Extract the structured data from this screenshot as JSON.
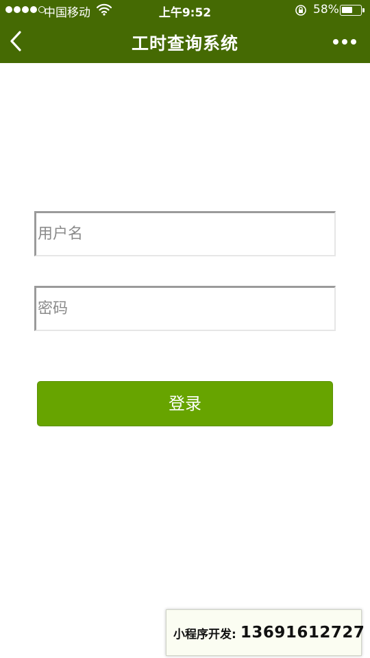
{
  "status_bar": {
    "carrier": "中国移动",
    "time": "上午9:52",
    "battery_percent": "58%",
    "battery_level": 0.58,
    "signal_strength": 4,
    "signal_max": 5,
    "icons": [
      "signal-icon",
      "wifi-icon",
      "rotation-lock-icon",
      "battery-icon"
    ]
  },
  "navbar": {
    "title": "工时查询系统",
    "back_icon": "chevron-left-icon",
    "more_icon": "more-dots-icon"
  },
  "form": {
    "username_placeholder": "用户名",
    "password_placeholder": "密码",
    "username_value": "",
    "password_value": "",
    "login_label": "登录"
  },
  "promo": {
    "label": "小程序开发:",
    "phone": "13691612727"
  },
  "colors": {
    "header_bg": "#456a03",
    "button_bg": "#67a400",
    "page_bg": "#ffffff",
    "text_white": "#ffffff"
  }
}
